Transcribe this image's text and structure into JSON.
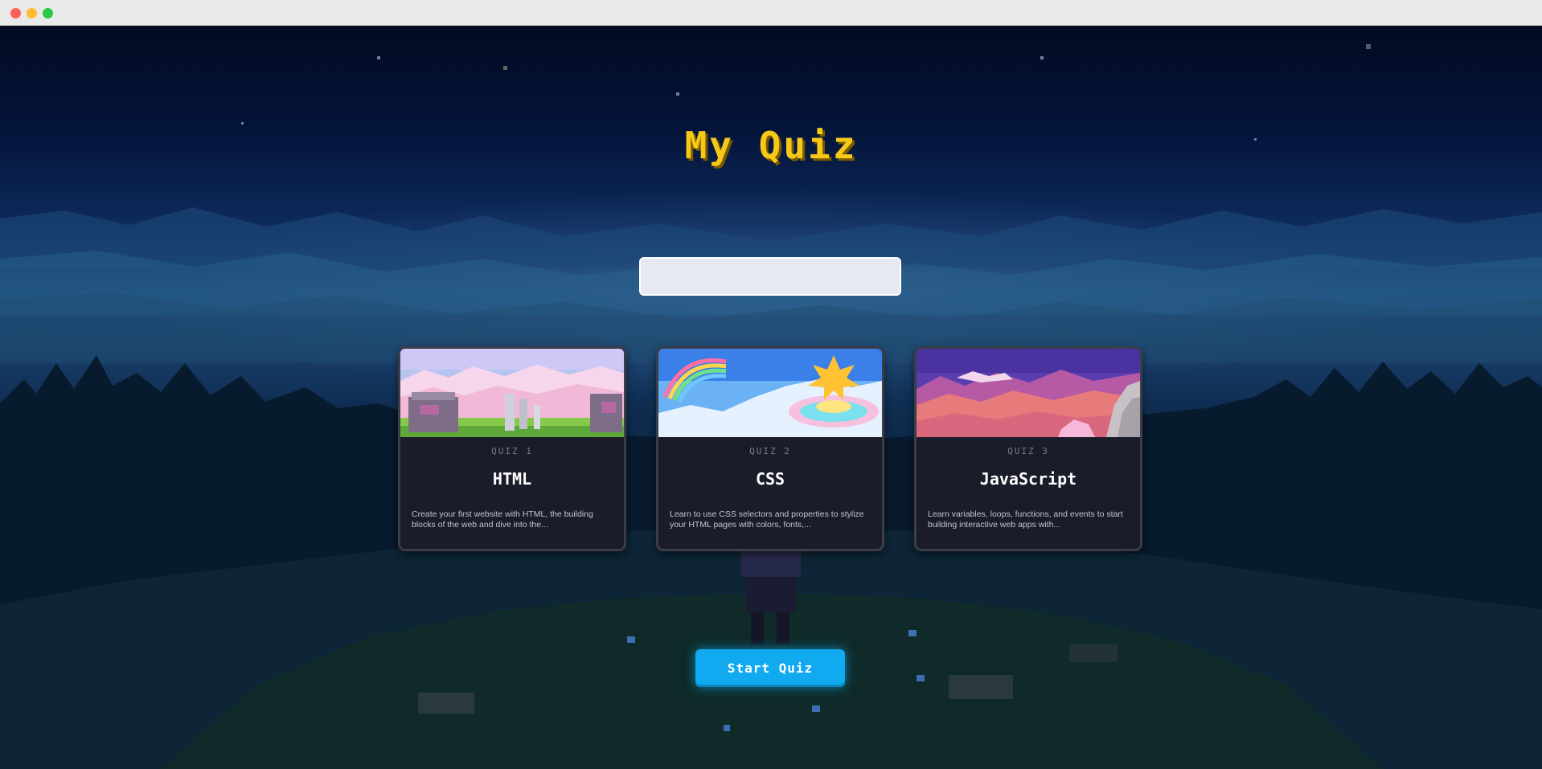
{
  "app": {
    "title": "My Quiz"
  },
  "search": {
    "value": "",
    "placeholder": ""
  },
  "quizzes": [
    {
      "number": "QUIZ 1",
      "title": "HTML",
      "description": "Create your first website with HTML, the building blocks of the web and dive into the..."
    },
    {
      "number": "QUIZ 2",
      "title": "CSS",
      "description": "Learn to use CSS selectors and properties to stylize your HTML pages with colors, fonts,..."
    },
    {
      "number": "QUIZ 3",
      "title": "JavaScript",
      "description": "Learn variables, loops, functions, and events to start building interactive web apps with..."
    }
  ],
  "actions": {
    "start_label": "Start Quiz"
  },
  "colors": {
    "title": "#f6c818",
    "button": "#11a9ef",
    "card_bg": "#1b1c2a",
    "card_border": "#3b3d49"
  },
  "icons": {
    "window_controls": [
      "close-icon",
      "minimize-icon",
      "maximize-icon"
    ]
  }
}
